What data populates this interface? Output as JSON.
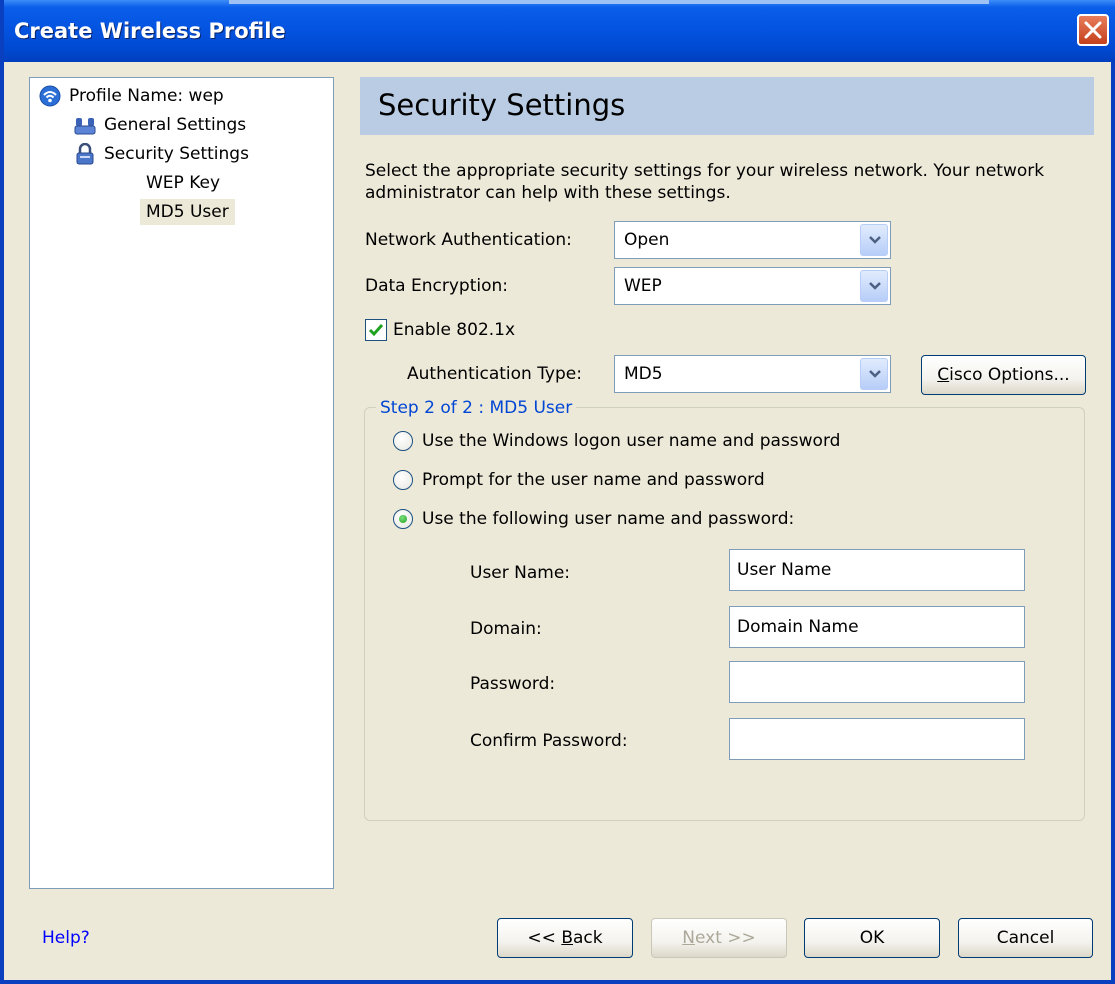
{
  "window": {
    "title": "Create Wireless Profile"
  },
  "tree": {
    "items": [
      {
        "label": "Profile Name: wep",
        "icon": "wireless-icon"
      },
      {
        "label": "General Settings",
        "icon": "users-icon"
      },
      {
        "label": "Security Settings",
        "icon": "lock-icon"
      },
      {
        "label": "WEP Key"
      },
      {
        "label": "MD5 User",
        "selected": true
      }
    ]
  },
  "header": {
    "title": "Security Settings"
  },
  "description": "Select the appropriate security settings for your wireless network. Your network administrator can help with these settings.",
  "form": {
    "network_auth_label": "Network Authentication:",
    "network_auth_value": "Open",
    "data_encryption_label": "Data Encryption:",
    "data_encryption_value": "WEP",
    "enable_8021x_label": "Enable 802.1x",
    "enable_8021x_checked": true,
    "auth_type_label": "Authentication Type:",
    "auth_type_value": "MD5",
    "cisco_options_prefix": "C",
    "cisco_options_rest": "isco Options..."
  },
  "group": {
    "legend": "Step 2 of 2 : MD5 User",
    "radios": [
      {
        "label": "Use the Windows logon user name and password",
        "selected": false
      },
      {
        "label": "Prompt for the user name and password",
        "selected": false
      },
      {
        "label": "Use the following user name and password:",
        "selected": true
      }
    ],
    "fields": {
      "user_name_label": "User Name:",
      "user_name_value": "User Name",
      "domain_label": "Domain:",
      "domain_value": "Domain Name",
      "password_label": "Password:",
      "password_value": "",
      "confirm_password_label": "Confirm Password:",
      "confirm_password_value": ""
    }
  },
  "footer": {
    "help_label": "Help?",
    "back_prefix": "<< ",
    "back_accel": "B",
    "back_rest": "ack",
    "next_accel": "N",
    "next_rest": "ext >>",
    "ok_label": "OK",
    "cancel_label": "Cancel"
  },
  "colors": {
    "title_bar": "#0454E1",
    "dialog_bg": "#ECE9D8",
    "header_band": "#B9CCE4",
    "legend_text": "#0046D5",
    "link": "#0000FF"
  }
}
